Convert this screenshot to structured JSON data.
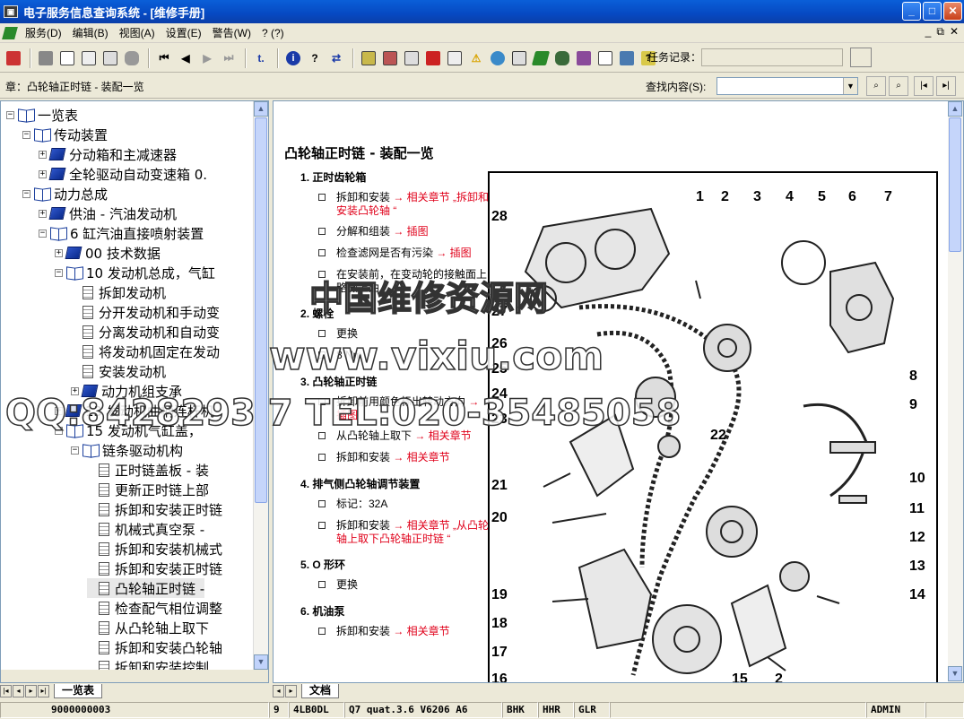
{
  "window": {
    "title": "电子服务信息查询系统 - [维修手册]",
    "icon": "app-icon",
    "minimize": "_",
    "maximize": "□",
    "close": "✕"
  },
  "menu": {
    "items": [
      "服务(D)",
      "编辑(B)",
      "视图(A)",
      "设置(E)",
      "警告(W)",
      "? (?)"
    ],
    "child_min": "_",
    "child_restore": "⧉",
    "child_close": "✕"
  },
  "toolbar": {
    "task_label": "任务记录：",
    "task_value": ""
  },
  "breadcrumb": "章：凸轮轴正时链 - 装配一览",
  "find": {
    "label": "查找内容(S):",
    "value": ""
  },
  "tree": {
    "nodes": [
      {
        "label": "一览表",
        "exp": "−",
        "icon": "book-open",
        "indent": 0
      },
      {
        "label": "传动装置",
        "exp": "−",
        "icon": "book-open",
        "indent": 1
      },
      {
        "label": "分动箱和主减速器",
        "exp": "+",
        "icon": "book",
        "indent": 2
      },
      {
        "label": "全轮驱动自动变速箱 0.",
        "exp": "+",
        "icon": "book",
        "indent": 2
      },
      {
        "label": "动力总成",
        "exp": "−",
        "icon": "book-open",
        "indent": 1
      },
      {
        "label": "供油 - 汽油发动机",
        "exp": "+",
        "icon": "book",
        "indent": 2
      },
      {
        "label": "6 缸汽油直接喷射装置",
        "exp": "−",
        "icon": "book-open",
        "indent": 2
      },
      {
        "label": "00 技术数据",
        "exp": "+",
        "icon": "book",
        "indent": 3
      },
      {
        "label": "10 发动机总成，气缸",
        "exp": "−",
        "icon": "book-open",
        "indent": 3
      },
      {
        "label": "拆卸发动机",
        "exp": "",
        "icon": "page",
        "indent": 4
      },
      {
        "label": "分开发动机和手动变",
        "exp": "",
        "icon": "page",
        "indent": 4
      },
      {
        "label": "分离发动机和自动变",
        "exp": "",
        "icon": "page",
        "indent": 4
      },
      {
        "label": "将发动机固定在发动",
        "exp": "",
        "icon": "page",
        "indent": 4
      },
      {
        "label": "安装发动机",
        "exp": "",
        "icon": "page",
        "indent": 4
      },
      {
        "label": "动力机组支承",
        "exp": "+",
        "icon": "book",
        "indent": 4
      },
      {
        "label": "13 发动机曲柄连杆机",
        "exp": "+",
        "icon": "book",
        "indent": 3
      },
      {
        "label": "15 发动机气缸盖，",
        "exp": "−",
        "icon": "book-open",
        "indent": 3
      },
      {
        "label": "链条驱动机构",
        "exp": "−",
        "icon": "book-open",
        "indent": 4
      },
      {
        "label": "正时链盖板 - 装",
        "exp": "",
        "icon": "page",
        "indent": 5
      },
      {
        "label": "更新正时链上部",
        "exp": "",
        "icon": "page",
        "indent": 5
      },
      {
        "label": "拆卸和安装正时链",
        "exp": "",
        "icon": "page",
        "indent": 5
      },
      {
        "label": "机械式真空泵 -",
        "exp": "",
        "icon": "page",
        "indent": 5
      },
      {
        "label": "拆卸和安装机械式",
        "exp": "",
        "icon": "page",
        "indent": 5
      },
      {
        "label": "拆卸和安装正时链",
        "exp": "",
        "icon": "page",
        "indent": 5
      },
      {
        "label": "凸轮轴正时链 -",
        "exp": "",
        "icon": "page",
        "indent": 5
      },
      {
        "label": "检查配气相位调整",
        "exp": "",
        "icon": "page",
        "indent": 5
      },
      {
        "label": "从凸轮轴上取下",
        "exp": "",
        "icon": "page",
        "indent": 5
      },
      {
        "label": "拆卸和安装凸轮轴",
        "exp": "",
        "icon": "page",
        "indent": 5
      },
      {
        "label": "拆卸和安装控制",
        "exp": "",
        "icon": "page",
        "indent": 5
      }
    ]
  },
  "left_tab": "一览表",
  "right_tab": "文档",
  "doc": {
    "title": "凸轮轴正时链 - 装配一览",
    "sections": [
      {
        "num": "1",
        "title": "正时齿轮箱",
        "items": [
          {
            "text": "拆卸和安装 ",
            "link": "→ 相关章节 „拆卸和安装凸轮轴 “"
          },
          {
            "text": "分解和组装 ",
            "link": "→ 插图"
          },
          {
            "text": "检查滤网是否有污染 ",
            "link": "→ 插图"
          },
          {
            "text": "在安装前，在变动轮的接触面上略微上油",
            "link": ""
          }
        ]
      },
      {
        "num": "2",
        "title": "螺栓",
        "items": [
          {
            "text": "更换",
            "link": ""
          },
          {
            "text": "8 Nm",
            "link": ""
          }
        ]
      },
      {
        "num": "3",
        "title": "凸轮轴正时链",
        "items": [
          {
            "text": "拆卸前用颜色标出转动方向 ",
            "link": "→ 插图"
          },
          {
            "text": "从凸轮轴上取下 ",
            "link": "→ 相关章节"
          },
          {
            "text": "拆卸和安装 ",
            "link": "→ 相关章节"
          }
        ]
      },
      {
        "num": "4",
        "title": "排气侧凸轮轴调节装置",
        "items": [
          {
            "text": "标记：32A",
            "link": ""
          },
          {
            "text": "拆卸和安装 ",
            "link": "→ 相关章节 „从凸轮轴上取下凸轮轴正时链 “"
          }
        ]
      },
      {
        "num": "5",
        "title": "O 形环",
        "items": [
          {
            "text": "更换",
            "link": ""
          }
        ]
      },
      {
        "num": "6",
        "title": "机油泵",
        "items": [
          {
            "text": "拆卸和安装 ",
            "link": "→ 相关章节"
          }
        ]
      }
    ]
  },
  "diagram_labels": [
    "1",
    "2",
    "3",
    "4",
    "5",
    "6",
    "7",
    "8",
    "9",
    "10",
    "11",
    "12",
    "13",
    "14",
    "15",
    "2",
    "16",
    "17",
    "18",
    "19",
    "20",
    "21",
    "22",
    "23",
    "24",
    "25",
    "26",
    "27",
    "28"
  ],
  "watermark": {
    "line1": "中国维修资源网",
    "line2": "www.vixiu.com",
    "line3": "QQ:8428293 7 TEL:020-35485058"
  },
  "status": [
    "9000000003",
    "9",
    "4LB0DL",
    "Q7 quat.3.6 V6206 A6",
    "BHK",
    "HHR",
    "GLR",
    "",
    "ADMIN",
    ""
  ]
}
